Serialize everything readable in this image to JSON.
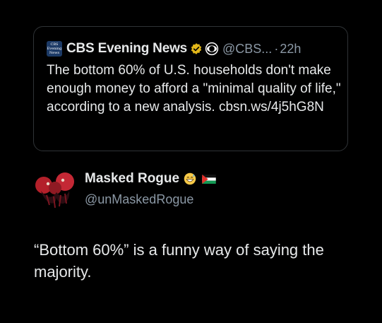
{
  "quoted_tweet": {
    "avatar_text": [
      "CBS",
      "Evening",
      "News"
    ],
    "name": "CBS Evening News",
    "handle": "@CBS...",
    "separator": "·",
    "time": "22h",
    "text": "The bottom 60% of U.S. households don't make enough money to afford a \"minimal quality of life,\" according to a new analysis. cbsn.ws/4j5hG8N"
  },
  "reply": {
    "name": "Masked Rogue",
    "handle": "@unMaskedRogue",
    "text": "“Bottom 60%” is a funny way of saying the majority."
  },
  "icons": {
    "verified": "verified-gold-icon",
    "cbs_eye": "cbs-eye-icon",
    "emoji": "grinning-face-sweat-icon",
    "flag": "palestine-flag-icon"
  },
  "colors": {
    "background": "#000000",
    "primary_text": "#e7e9ea",
    "secondary_text": "#8b98a5",
    "border": "#2f3336",
    "verified_gold": "#e2b719"
  }
}
